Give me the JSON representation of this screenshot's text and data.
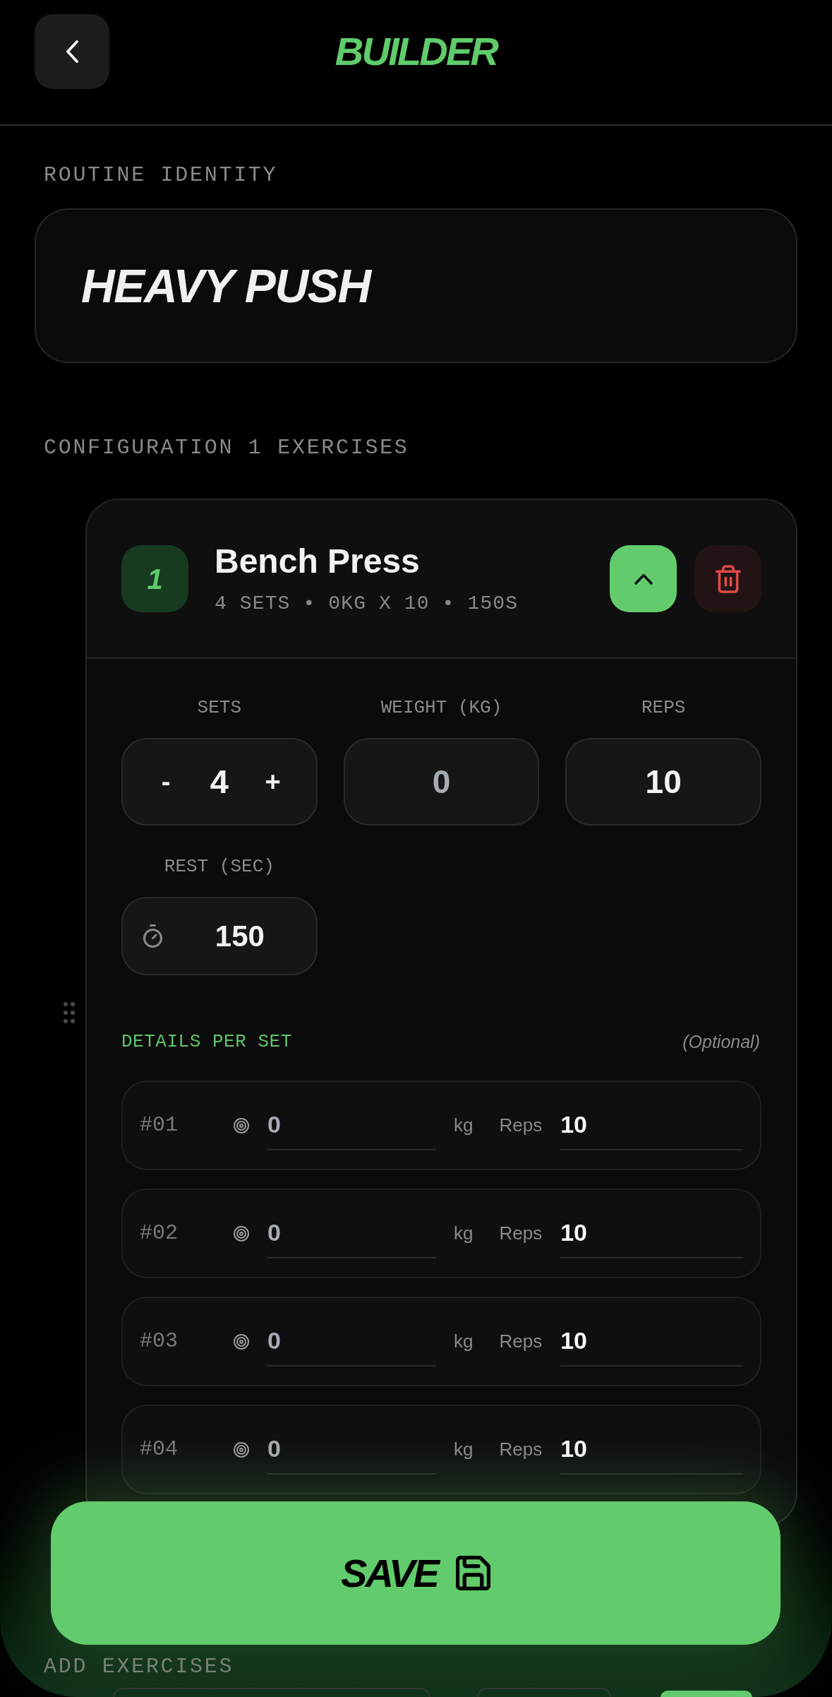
{
  "header": {
    "title": "BUILDER"
  },
  "routine": {
    "label": "ROUTINE IDENTITY",
    "name": "HEAVY PUSH"
  },
  "configuration": {
    "label": "CONFIGURATION 1 EXERCISES"
  },
  "exercises": [
    {
      "number": "1",
      "name": "Bench Press",
      "summary": "4 SETS • 0KG X 10 • 150S",
      "expanded": true,
      "fields": [
        {
          "kind": "stepper",
          "label": "SETS",
          "decrement": "-",
          "value": "4",
          "increment": "+"
        },
        {
          "kind": "number",
          "label": "WEIGHT (KG)",
          "placeholder": "0"
        },
        {
          "kind": "number",
          "label": "REPS",
          "value": "10"
        },
        {
          "kind": "timer",
          "label": "REST (SEC)",
          "value": "150"
        }
      ],
      "details": {
        "title": "DETAILS PER SET",
        "note": "(Optional)",
        "sets": [
          {
            "index": "#01",
            "weight_placeholder": "0",
            "unit": "kg",
            "reps_label": "Reps",
            "reps": "10"
          },
          {
            "index": "#02",
            "weight_placeholder": "0",
            "unit": "kg",
            "reps_label": "Reps",
            "reps": "10"
          },
          {
            "index": "#03",
            "weight_placeholder": "0",
            "unit": "kg",
            "reps_label": "Reps",
            "reps": "10"
          },
          {
            "index": "#04",
            "weight_placeholder": "0",
            "unit": "kg",
            "reps_label": "Reps",
            "reps": "10"
          }
        ]
      }
    }
  ],
  "add_exercises": {
    "label": "ADD EXERCISES"
  },
  "save_button": {
    "label": "SAVE"
  }
}
